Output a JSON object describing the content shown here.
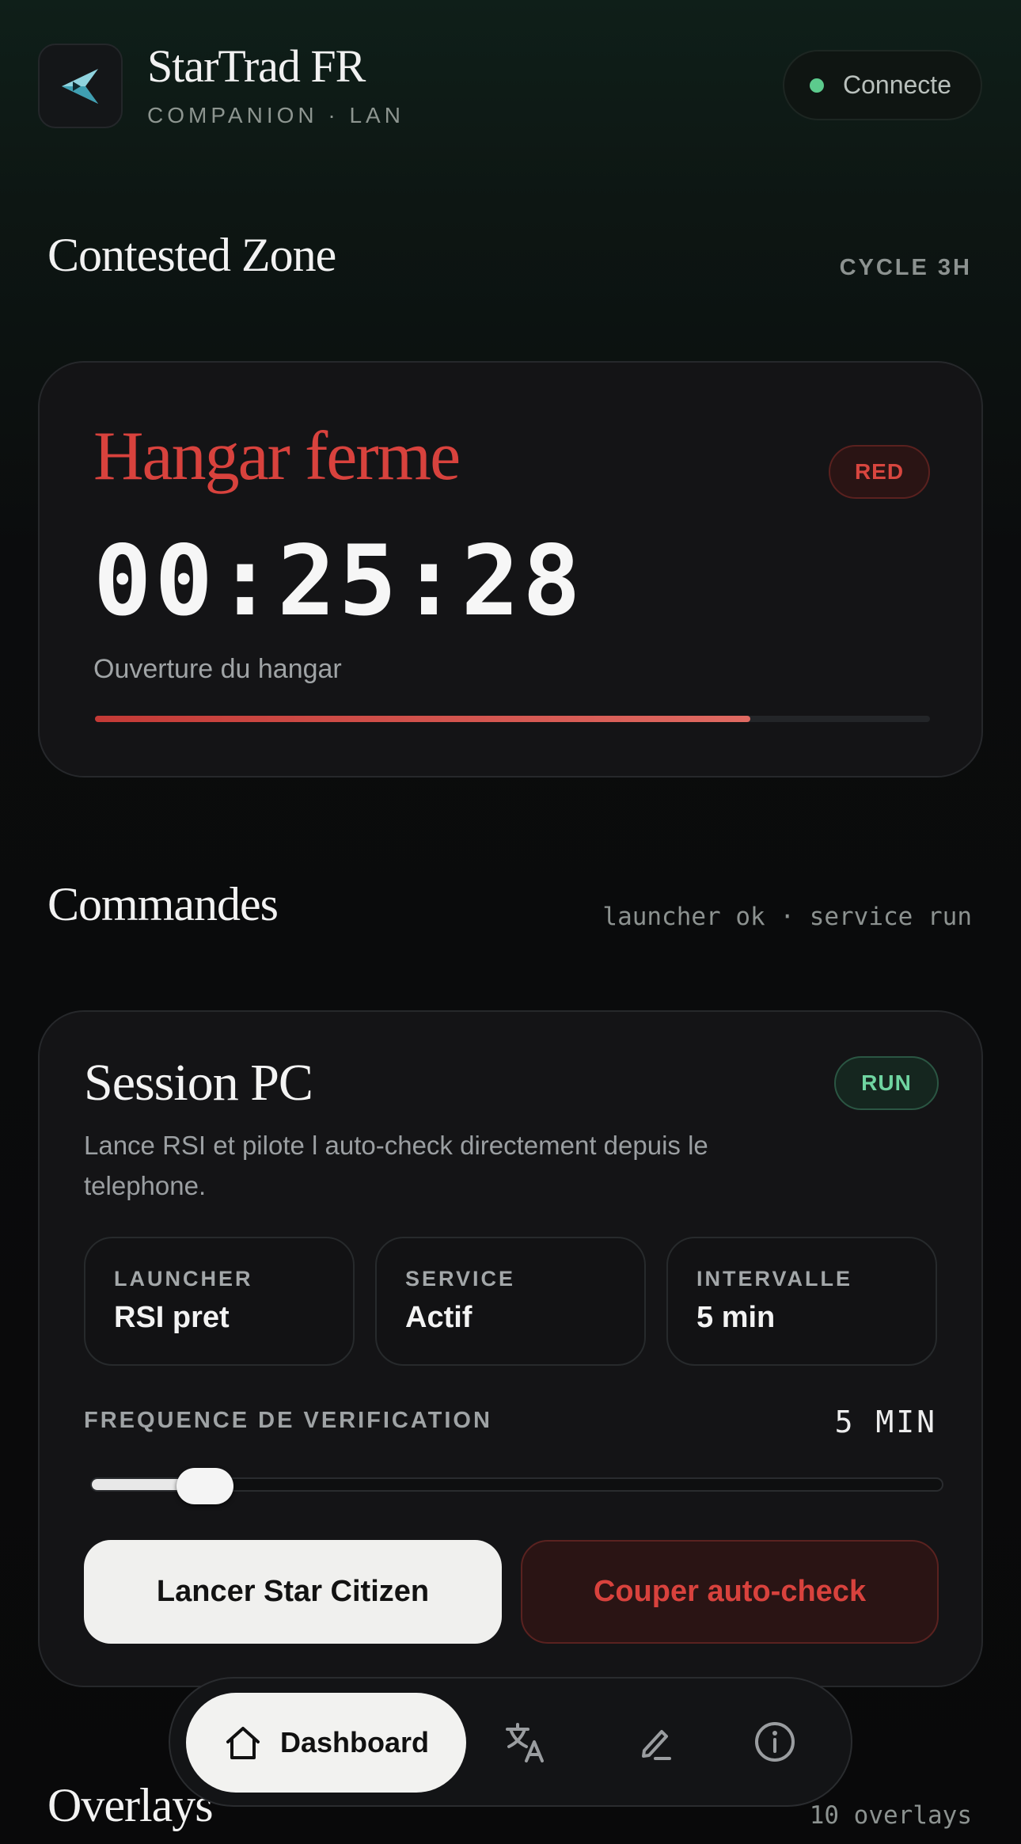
{
  "header": {
    "app_title": "StarTrad FR",
    "app_subtitle": "COMPANION · LAN",
    "logo_icon": "star-ship-icon",
    "connection": {
      "label": "Connecte",
      "status_color": "#5ccb8d"
    }
  },
  "contested_zone": {
    "section_title": "Contested Zone",
    "cycle_label": "CYCLE 3H",
    "status_title": "Hangar ferme",
    "status_badge": "RED",
    "timer": "00:25:28",
    "caption": "Ouverture du hangar",
    "progress": 0.785,
    "accent_color": "#d8423d"
  },
  "commandes": {
    "section_title": "Commandes",
    "status_line": "launcher ok · service run",
    "session": {
      "title": "Session PC",
      "badge": "RUN",
      "description": "Lance RSI et pilote l auto-check directement depuis le telephone.",
      "stats": [
        {
          "label": "LAUNCHER",
          "value": "RSI pret"
        },
        {
          "label": "SERVICE",
          "value": "Actif"
        },
        {
          "label": "INTERVALLE",
          "value": "5 min"
        }
      ],
      "frequency": {
        "label": "FREQUENCE DE VERIFICATION",
        "value_text": "5 MIN",
        "level": 0.1
      },
      "launch_button": "Lancer Star Citizen",
      "stop_button": "Couper auto-check"
    }
  },
  "overlays": {
    "section_title": "Overlays",
    "count_label": "10 overlays"
  },
  "bottom_nav": {
    "active_label": "Dashboard",
    "items": [
      {
        "icon": "home-icon"
      },
      {
        "icon": "translate-icon"
      },
      {
        "icon": "edit-pencil-icon"
      },
      {
        "icon": "info-icon"
      }
    ]
  }
}
